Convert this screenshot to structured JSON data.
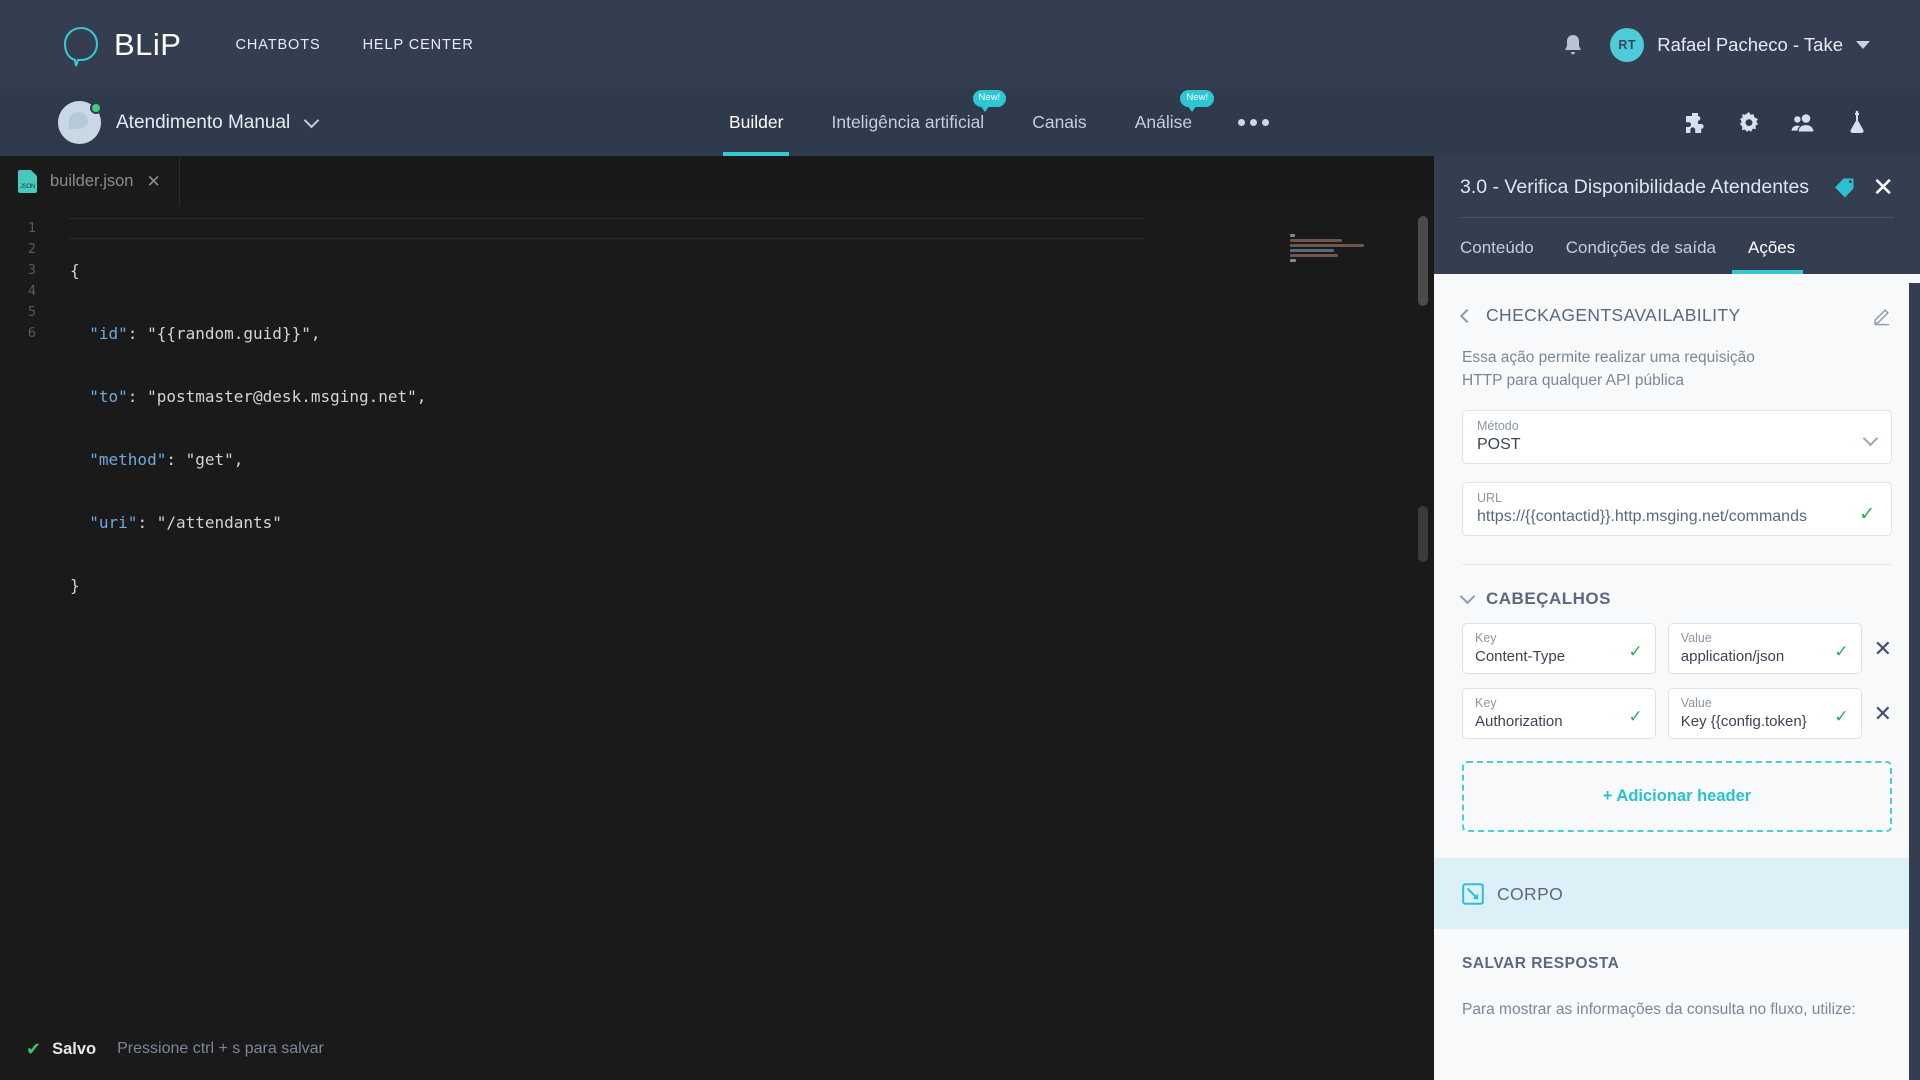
{
  "topbar": {
    "logo_text": "BLiP",
    "logo_icon": "blip-balloon-icon",
    "nav": [
      {
        "label": "CHATBOTS"
      },
      {
        "label": "HELP CENTER"
      }
    ],
    "notification_icon": "bell-icon",
    "user": {
      "initials": "RT",
      "name": "Rafael Pacheco - Take",
      "caret_icon": "chevron-down-icon"
    }
  },
  "subbar": {
    "bot_name": "Atendimento Manual",
    "bot_status": "online",
    "bot_chevron_icon": "chevron-down-icon",
    "tabs": [
      {
        "label": "Builder",
        "active": true,
        "badge": ""
      },
      {
        "label": "Inteligência artificial",
        "active": false,
        "badge": "New!"
      },
      {
        "label": "Canais",
        "active": false,
        "badge": ""
      },
      {
        "label": "Análise",
        "active": false,
        "badge": "New!"
      }
    ],
    "more_icon": "ellipsis-icon",
    "right_icons": [
      "puzzle-piece-icon",
      "gear-icon",
      "users-icon",
      "flask-icon"
    ]
  },
  "editor": {
    "tab": {
      "filename": "builder.json",
      "file_icon": "json-file-icon",
      "close_icon": "close-icon"
    },
    "lines": [
      {
        "n": "1",
        "html": "{"
      },
      {
        "n": "2",
        "html": "  \"id\": \"{{random.guid}}\","
      },
      {
        "n": "3",
        "html": "  \"to\": \"postmaster@desk.msging.net\","
      },
      {
        "n": "4",
        "html": "  \"method\": \"get\","
      },
      {
        "n": "5",
        "html": "  \"uri\": \"/attendants\""
      },
      {
        "n": "6",
        "html": "}"
      }
    ],
    "status": {
      "check_icon": "check-icon",
      "saved_label": "Salvo",
      "hint": "Pressione ctrl + s para salvar"
    }
  },
  "panel": {
    "title": "3.0 - Verifica Disponibilidade Atendentes",
    "tag_icon": "tag-icon",
    "close_icon": "close-icon",
    "tabs": [
      {
        "label": "Conteúdo",
        "active": false
      },
      {
        "label": "Condições de saída",
        "active": false
      },
      {
        "label": "Ações",
        "active": true
      }
    ],
    "action": {
      "back_icon": "chevron-left-icon",
      "name": "CHECKAGENTSAVAILABILITY",
      "edit_icon": "pencil-icon",
      "description": "Essa ação permite realizar uma requisição HTTP para qualquer API pública",
      "method_label": "Método",
      "method_value": "POST",
      "method_chevron_icon": "chevron-down-icon",
      "url_label": "URL",
      "url_value": "https://{{contactid}}.http.msging.net/commands",
      "url_valid_icon": "check-icon"
    },
    "headers": {
      "collapse_icon": "chevron-down-icon",
      "section_title": "CABEÇALHOS",
      "key_label": "Key",
      "value_label": "Value",
      "rows": [
        {
          "key": "Content-Type",
          "value": "application/json",
          "key_valid_icon": "check-icon",
          "value_valid_icon": "check-icon",
          "remove_icon": "close-icon"
        },
        {
          "key": "Authorization",
          "value": "Key {{config.token}",
          "key_valid_icon": "check-icon",
          "value_valid_icon": "check-icon",
          "remove_icon": "close-icon"
        }
      ],
      "add_label": "+ Adicionar header"
    },
    "body_section": {
      "icon": "expand-body-icon",
      "title": "CORPO"
    },
    "save_response": {
      "title": "SALVAR RESPOSTA",
      "description": "Para mostrar as informações da consulta no fluxo, utilize:"
    }
  },
  "colors": {
    "topbar_bg": "#353d51",
    "subbar_bg": "#2f3a4c",
    "accent": "#38c5d4",
    "editor_bg": "#1a1a1a",
    "panel_bg": "#f7f9fa",
    "success": "#2faa5a",
    "online": "#3fce7d",
    "corpo_band": "#def0f7"
  }
}
